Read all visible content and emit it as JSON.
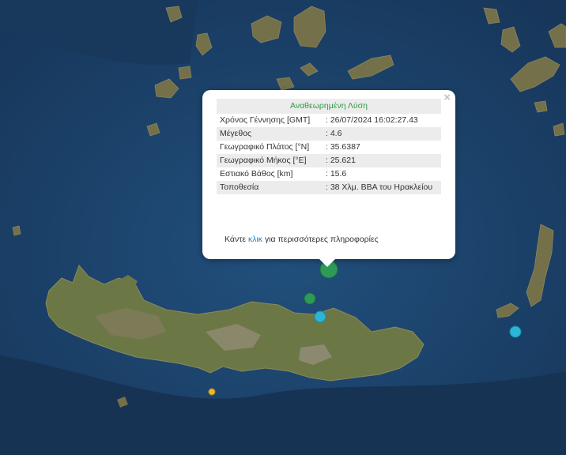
{
  "popup": {
    "title": "Αναθεωρημένη Λύση",
    "close_glyph": "×",
    "rows": [
      {
        "label": "Χρόνος Γέννησης [GMT]",
        "value": ": 26/07/2024 16:02:27.43"
      },
      {
        "label": "Μέγεθος",
        "value": ": 4.6"
      },
      {
        "label": "Γεωγραφικό Πλάτος [°N]",
        "value": ": 35.6387"
      },
      {
        "label": "Γεωγραφικό Μήκος [°E]",
        "value": ": 25.621"
      },
      {
        "label": "Εστιακό Βάθος [km]",
        "value": ": 15.6"
      },
      {
        "label": "Τοποθεσία",
        "value": ": 38 Χλμ. ΒΒΑ του Ηρακλείου"
      }
    ],
    "more_prefix": "Κάντε ",
    "more_link": "κλικ",
    "more_suffix": " για περισσότερες πληροφορίες"
  },
  "colors": {
    "sea": "#1b3f66",
    "land": "#6f7a4a",
    "popup_title": "#2f9a45",
    "link": "#1b7fc6",
    "marker_green": "#2e9a57",
    "marker_cyan": "#2bb5d6",
    "marker_yellow": "#e8b830"
  }
}
